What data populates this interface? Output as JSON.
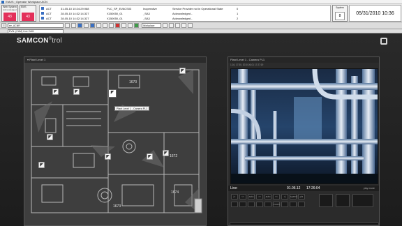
{
  "window": {
    "title": "EMUS | Operator Workplace ACN"
  },
  "alarm_header": {
    "tiles": [
      {
        "label": "Web System",
        "sub": "Acknowledged",
        "value": "43"
      },
      {
        "label": "EMS",
        "sub": "",
        "value": "43"
      }
    ],
    "alarms": [
      {
        "state": "ACT",
        "time": "31-05-10 10:24:29.968",
        "source": "PLC_SP_EVACS03",
        "status": "Inoperative",
        "message": "Service Provider not in Operational State",
        "count": "0",
        "color": "#3a6fc2"
      },
      {
        "state": "ACT",
        "time": "28-05-10 14:32:14.327",
        "source": "X150050_01",
        "status": "_SA3",
        "message": "Acknowledged -",
        "count": "1",
        "color": "#3a6fc2"
      },
      {
        "state": "ACT",
        "time": "28-05-10 14:32:14.327",
        "source": "X150050_01",
        "status": "_SA3",
        "message": "Acknowledged -",
        "count": "2",
        "color": "#3a6fc2"
      }
    ],
    "system": {
      "label": "System",
      "value": "8"
    },
    "datetime": "05/31/2010 10:36"
  },
  "toolbar": {
    "user_value": "ee_ACNR",
    "layout_value": "Workplace",
    "address_value": "EVN: (CAM) Live CAM"
  },
  "app": {
    "logo_main": "SAMCON",
    "logo_tail": "trol",
    "plan": {
      "header": "Plant Level 1",
      "rooms": [
        "1670",
        "1672",
        "1674",
        "1673"
      ],
      "tooltip": "Plant Level 1 - Camera PL1"
    },
    "camera": {
      "header": "Plant Level 1 - Camera PL1",
      "subheader": "1.16, 17:30, 2010-06-01 17:27:19",
      "live_label": "Live:",
      "date": "01.06.12",
      "time": "17:26:04",
      "mode": "play mode",
      "controls": [
        "|<",
        "<<",
        "auto",
        ">>",
        "auto",
        "<<",
        ">|",
        "speed",
        "ptz",
        "",
        "",
        "",
        "",
        "",
        "zoom",
        "",
        "",
        ""
      ]
    }
  }
}
